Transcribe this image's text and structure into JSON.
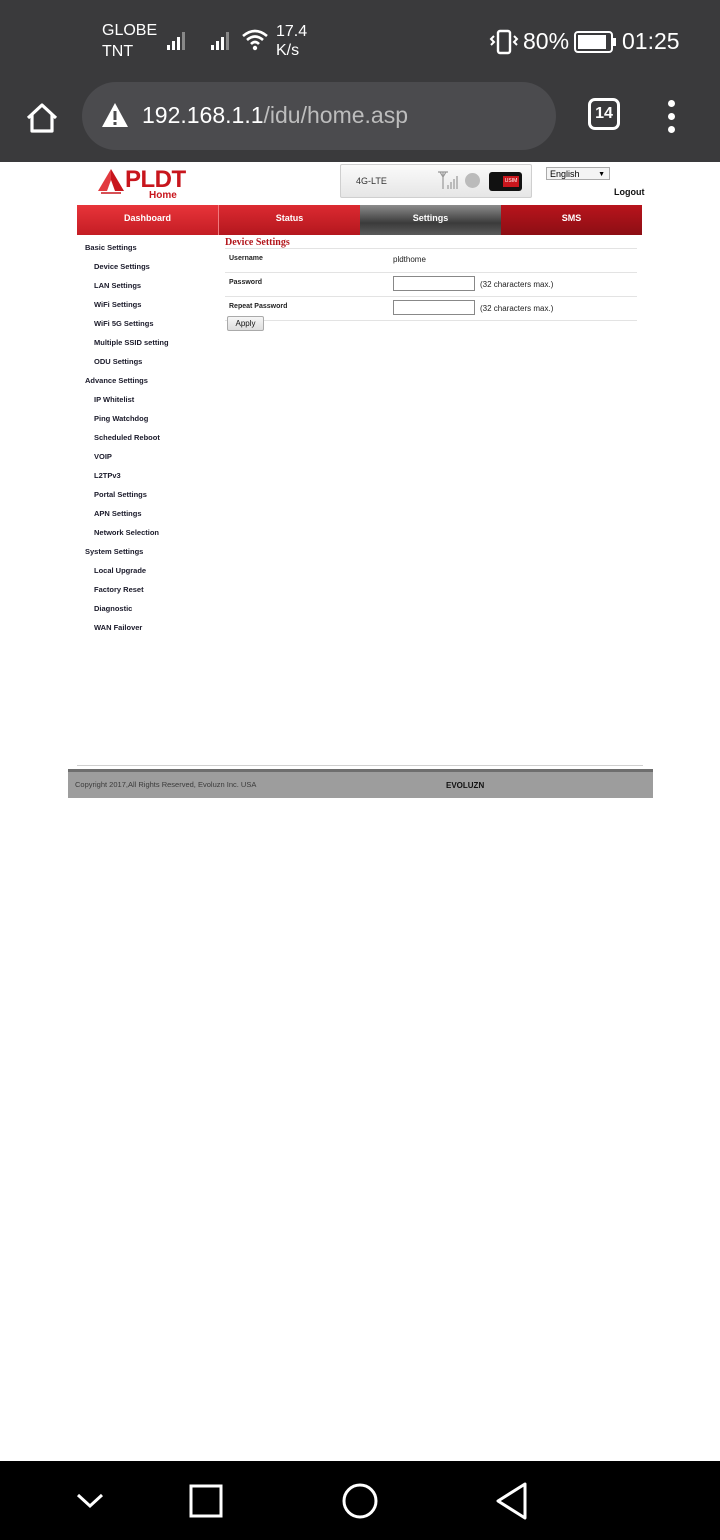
{
  "status_bar": {
    "carrier1": "GLOBE",
    "carrier2": "TNT",
    "speed_value": "17.4",
    "speed_unit": "K/s",
    "battery": "80%",
    "time": "01:25"
  },
  "browser": {
    "url_host": "192.168.1.1",
    "url_path": "/idu/home.asp",
    "tab_count": "14"
  },
  "header": {
    "logo_text": "PLDT",
    "logo_sub": "Home",
    "network_type": "4G-LTE",
    "sim_label": "USIM",
    "language": "English",
    "logout": "Logout"
  },
  "menu": {
    "dashboard": "Dashboard",
    "status": "Status",
    "settings": "Settings",
    "sms": "SMS"
  },
  "sidebar": {
    "basic": "Basic Settings",
    "basic_items": [
      "Device Settings",
      "LAN Settings",
      "WiFi Settings",
      "WiFi 5G Settings",
      "Multiple SSID setting",
      "ODU Settings"
    ],
    "advance": "Advance Settings",
    "advance_items": [
      "IP Whitelist",
      "Ping Watchdog",
      "Scheduled Reboot",
      "VOIP",
      "L2TPv3",
      "Portal Settings",
      "APN Settings",
      "Network Selection"
    ],
    "system": "System Settings",
    "system_items": [
      "Local Upgrade",
      "Factory Reset",
      "Diagnostic",
      "WAN Failover"
    ]
  },
  "form": {
    "title": "Device Settings",
    "username_label": "Username",
    "username_value": "pldthome",
    "password_label": "Password",
    "password_hint": "(32 characters max.)",
    "repeat_label": "Repeat Password",
    "repeat_hint": "(32 characters max.)",
    "apply": "Apply"
  },
  "footer": {
    "copyright": "Copyright 2017,All Rights Reserved, Evoluzn Inc. USA",
    "brand": "EVOLUZN"
  },
  "colors": {
    "brand_red": "#c8161d",
    "system_bar": "#3a3a3c"
  }
}
